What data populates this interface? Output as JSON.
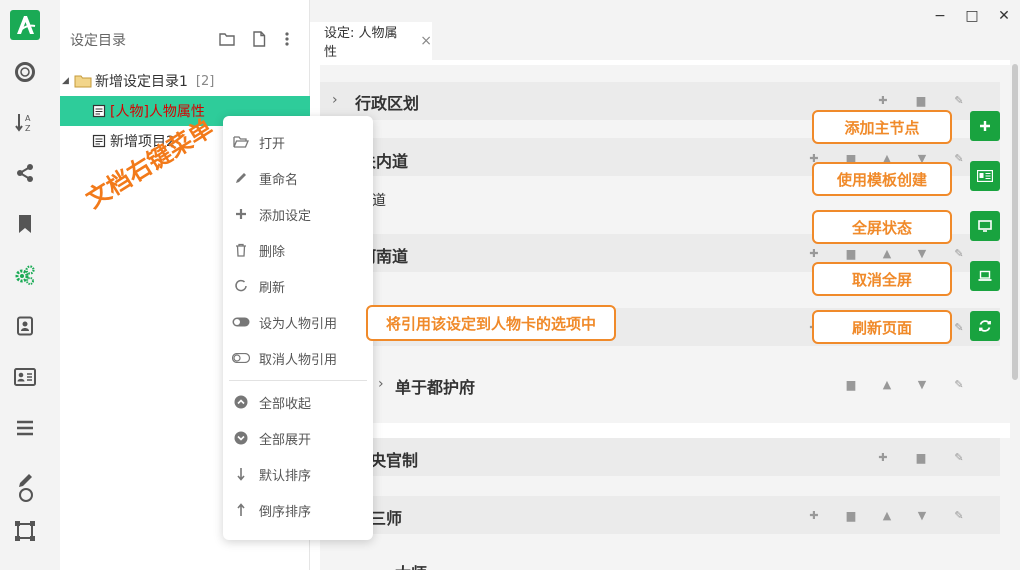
{
  "tree": {
    "title": "设定目录",
    "nodes": [
      {
        "label": "新增设定目录1",
        "count": "[2]"
      },
      {
        "label": "[人物]人物属性"
      },
      {
        "label": "新增项目2"
      }
    ]
  },
  "annotations": {
    "right_click_menu": "文档右键菜单",
    "reference_hint": "将引用该设定到人物卡的选项中",
    "add_root": "添加主节点",
    "use_template": "使用模板创建",
    "fullscreen": "全屏状态",
    "exit_fullscreen": "取消全屏",
    "refresh_page": "刷新页面"
  },
  "context_menu": {
    "items": [
      {
        "label": "打开",
        "icon": "folder-open-icon"
      },
      {
        "label": "重命名",
        "icon": "pencil-icon"
      },
      {
        "label": "添加设定",
        "icon": "plus-icon"
      },
      {
        "label": "删除",
        "icon": "trash-icon"
      },
      {
        "label": "刷新",
        "icon": "refresh-icon"
      },
      {
        "label": "设为人物引用",
        "icon": "toggle-on-icon"
      },
      {
        "label": "取消人物引用",
        "icon": "toggle-off-icon"
      },
      {
        "label": "全部收起",
        "icon": "chevron-up-circle-icon"
      },
      {
        "label": "全部展开",
        "icon": "chevron-down-circle-icon"
      },
      {
        "label": "默认排序",
        "icon": "arrow-down-icon"
      },
      {
        "label": "倒序排序",
        "icon": "arrow-up-icon"
      }
    ]
  },
  "tab": {
    "label": "设定: 人物属性",
    "close": "×"
  },
  "window": {
    "minimize": "−",
    "maximize": "□",
    "close": "✕"
  },
  "content": {
    "rows": [
      {
        "title": "行政区划"
      },
      {
        "title": "关内道"
      },
      {
        "title": "道"
      },
      {
        "title": "河南道"
      },
      {
        "title": "单于都护府"
      },
      {
        "title": "央官制"
      },
      {
        "title": "三师"
      },
      {
        "title": "太师"
      }
    ]
  },
  "colors": {
    "accent": "#2ecc9a",
    "brand": "#1aaa55",
    "annotation": "#f08a2a",
    "button_green": "#19a33f"
  }
}
